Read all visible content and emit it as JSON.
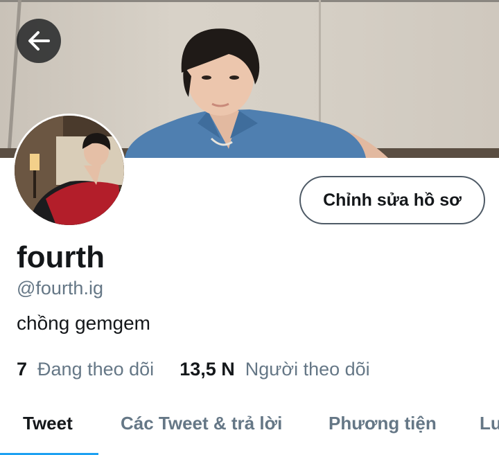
{
  "header": {
    "back_icon": "arrow-left-icon"
  },
  "profile": {
    "edit_button_label": "Chỉnh sửa hồ sơ",
    "display_name": "fourth",
    "handle": "@fourth.ig",
    "bio": "chồng gemgem",
    "following_count": "7",
    "following_label": "Đang theo dõi",
    "followers_count": "13,5 N",
    "followers_label": "Người theo dõi"
  },
  "tabs": [
    {
      "label": "Tweet",
      "active": true
    },
    {
      "label": "Các Tweet & trả lời",
      "active": false
    },
    {
      "label": "Phương tiện",
      "active": false
    },
    {
      "label": "Lượt thích",
      "active": false
    }
  ],
  "colors": {
    "accent": "#1da1f2",
    "secondary_text": "#657786",
    "primary_text": "#14171a"
  }
}
